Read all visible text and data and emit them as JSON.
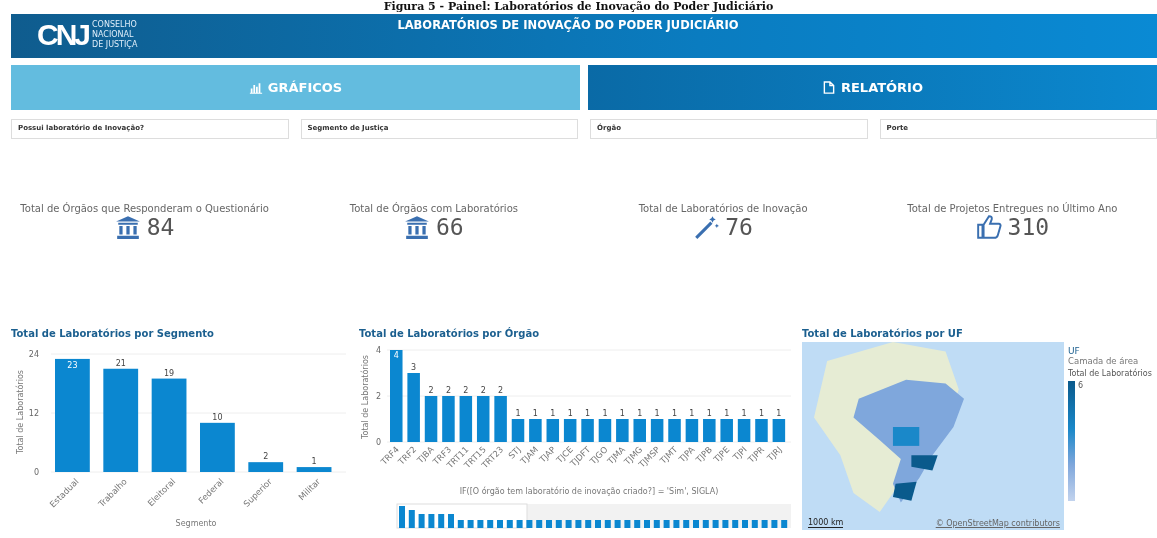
{
  "caption": "Figura 5 - Painel: Laboratórios de Inovação do Poder Judiciário",
  "header": {
    "logo": "CNJ",
    "logo_text": [
      "CONSELHO",
      "NACIONAL",
      "DE JUSTIÇA"
    ],
    "title": "LABORATÓRIOS DE INOVAÇÃO DO PODER JUDICIÁRIO"
  },
  "tabs": [
    {
      "label": "GRÁFICOS",
      "kind": "chart",
      "selected": true
    },
    {
      "label": "RELATÓRIO",
      "kind": "document",
      "selected": false
    }
  ],
  "filters": [
    "Possui laboratório de Inovação?",
    "Segmento de Justiça",
    "Órgão",
    "Porte"
  ],
  "kpis": [
    {
      "label": "Total de Órgãos que Responderam o Questionário",
      "kind": "institution",
      "value": "84"
    },
    {
      "label": "Total de Órgãos com Laboratórios",
      "kind": "institution",
      "value": "66"
    },
    {
      "label": "Total de Laboratórios de Inovação",
      "kind": "wand",
      "value": "76"
    },
    {
      "label": "Total de Projetos Entregues no Último Ano",
      "kind": "like",
      "value": "310"
    }
  ],
  "segment_chart": {
    "chart_data": {
      "type": "bar",
      "title": "Total de Laboratórios por Segmento",
      "xlabel": "Segmento",
      "ylabel": "Total de Laboratórios",
      "categories": [
        "Estadual",
        "Trabalho",
        "Eleitoral",
        "Federal",
        "Superior",
        "Militar"
      ],
      "values": [
        23,
        21,
        19,
        10,
        2,
        1
      ],
      "ylim": [
        0,
        24
      ],
      "yticks": [
        0,
        12,
        24
      ],
      "data_labels": true
    }
  },
  "organ_chart": {
    "chart_data": {
      "type": "bar",
      "title": "Total de Laboratórios por Órgão",
      "xlabel": "IF([O órgão tem laboratório de inovação criado?] = 'Sim', SIGLA)",
      "ylabel": "Total de Laboratórios",
      "categories": [
        "TRF4",
        "TRF2",
        "TJBA",
        "TRF3",
        "TRT11",
        "TRT15",
        "TRT23",
        "STJ",
        "TJAM",
        "TJAP",
        "TJCE",
        "TJDFT",
        "TJGO",
        "TJMA",
        "TJMG",
        "TJMSP",
        "TJMT",
        "TJPA",
        "TJPB",
        "TJPE",
        "TJPI",
        "TJPR",
        "TJRJ"
      ],
      "values": [
        4,
        3,
        2,
        2,
        2,
        2,
        2,
        1,
        1,
        1,
        1,
        1,
        1,
        1,
        1,
        1,
        1,
        1,
        1,
        1,
        1,
        1,
        1
      ],
      "ylim": [
        0,
        4
      ],
      "yticks": [
        0,
        2,
        4
      ],
      "data_labels": true
    }
  },
  "map_panel": {
    "title": "Total de Laboratórios por UF",
    "scale": "1000 km",
    "attribution": "© OpenStreetMap contributors",
    "legend_title": "UF",
    "legend_layer": "Camada de área",
    "legend_measure": "Total de Laboratórios",
    "legend_max": "6"
  }
}
